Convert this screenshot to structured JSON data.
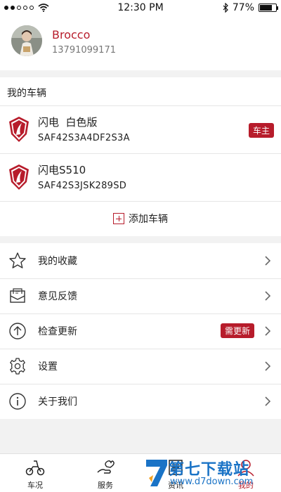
{
  "status": {
    "time": "12:30 PM",
    "battery": "77%",
    "battery_level": 0.77
  },
  "profile": {
    "name": "Brocco",
    "phone": "13791099171"
  },
  "vehicles": {
    "title": "我的车辆",
    "items": [
      {
        "name": "闪电  白色版",
        "vin": "SAF42S3A4DF2S3A",
        "badge": "车主"
      },
      {
        "name": "闪电S510",
        "vin": "SAF42S3JSK289SD"
      }
    ],
    "add_label": "添加车辆"
  },
  "menu": {
    "items": [
      {
        "label": "我的收藏",
        "icon": "star-icon"
      },
      {
        "label": "意见反馈",
        "icon": "feedback-icon"
      },
      {
        "label": "检查更新",
        "icon": "update-icon",
        "badge": "需更新"
      },
      {
        "label": "设置",
        "icon": "settings-icon"
      },
      {
        "label": "关于我们",
        "icon": "info-icon"
      }
    ]
  },
  "tabbar": {
    "tabs": [
      {
        "label": "车况",
        "icon": "scooter-icon"
      },
      {
        "label": "服务",
        "icon": "service-icon"
      },
      {
        "label": "资讯",
        "icon": "news-icon"
      },
      {
        "label": "我的",
        "icon": "user-icon",
        "active": true
      }
    ]
  },
  "watermark": {
    "main": "第七下载站",
    "url": "www.d7down.com"
  },
  "colors": {
    "accent": "#b71c2b",
    "watermark": "#1a73c6"
  }
}
